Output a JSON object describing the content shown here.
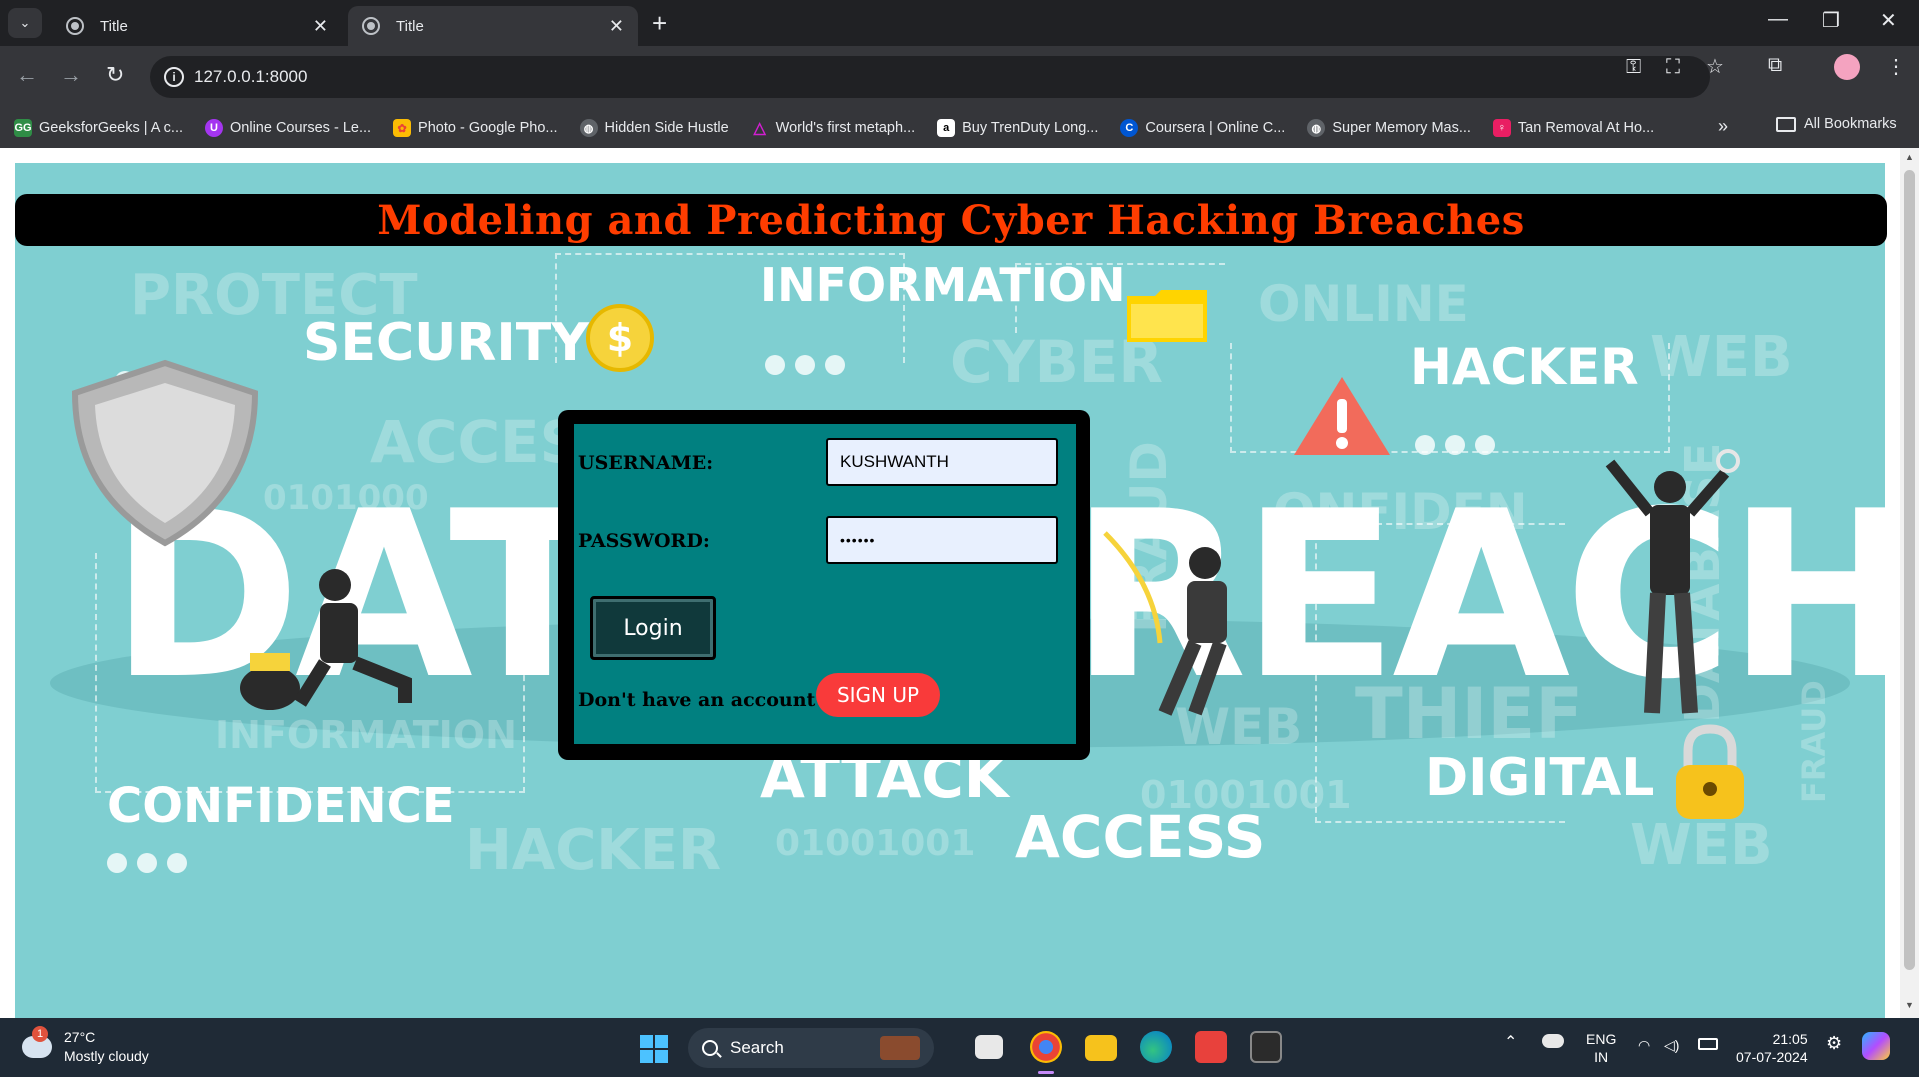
{
  "browser": {
    "tabs": [
      {
        "title": "Title",
        "active": false
      },
      {
        "title": "Title",
        "active": true
      }
    ],
    "new_tab_label": "+",
    "address": "127.0.0.1:8000",
    "bookmarks": [
      {
        "label": "GeeksforGeeks | A c...",
        "icon_color": "#2f8d46",
        "icon_text": "GG"
      },
      {
        "label": "Online Courses - Le...",
        "icon_color": "#a435f0",
        "icon_text": "U"
      },
      {
        "label": "Photo - Google Pho...",
        "icon_color": "#ea4335",
        "icon_text": "✿"
      },
      {
        "label": "Hidden Side Hustle",
        "icon_color": "#5f6368",
        "icon_text": "◍"
      },
      {
        "label": "World's first metaph...",
        "icon_color": "#d11fd1",
        "icon_text": "△"
      },
      {
        "label": "Buy TrenDuty Long...",
        "icon_color": "#ffffff",
        "icon_text": "a"
      },
      {
        "label": "Coursera | Online C...",
        "icon_color": "#0056d2",
        "icon_text": "C"
      },
      {
        "label": "Super Memory Mas...",
        "icon_color": "#5f6368",
        "icon_text": "◍"
      },
      {
        "label": "Tan Removal At Ho...",
        "icon_color": "#e91e63",
        "icon_text": "♀"
      }
    ],
    "more_bookmarks": "»",
    "all_bookmarks": "All Bookmarks"
  },
  "page": {
    "title": "Modeling and Predicting Cyber Hacking Breaches",
    "login": {
      "username_label": "USERNAME:",
      "username_value": "KUSHWANTH",
      "password_label": "PASSWORD:",
      "password_value": "••••••",
      "login_button": "Login",
      "signup_prompt": "Don't have an account?",
      "signup_button": "SIGN UP"
    },
    "background_words": {
      "protect": "PROTECT",
      "security": "SECURITY",
      "information_top": "INFORMATION",
      "cyber": "CYBER",
      "online": "ONLINE",
      "web_top": "WEB",
      "hacker_top": "HACKER",
      "access_faint": "ACCES",
      "data": "DAT",
      "breach": "REACH",
      "binary_left": "0101000",
      "fraud": "FRAUD",
      "confidence_faint": "ONFIDEN",
      "thief": "THIEF",
      "web_mid": "WEB",
      "information_bottom": "INFORMATION",
      "attack": "ATTACK",
      "digital": "DIGITAL",
      "binary_mid": "01001001",
      "binary_bottom": "01001001",
      "confidence": "CONFIDENCE",
      "hacker_bottom": "HACKER",
      "access": "ACCESS",
      "web_bottom": "WEB",
      "database": "DATABASE",
      "fraud_right": "FRAUD"
    }
  },
  "taskbar": {
    "weather_temp": "27°C",
    "weather_desc": "Mostly cloudy",
    "weather_badge": "1",
    "search_placeholder": "Search",
    "lang_line1": "ENG",
    "lang_line2": "IN",
    "time": "21:05",
    "date": "07-07-2024"
  }
}
